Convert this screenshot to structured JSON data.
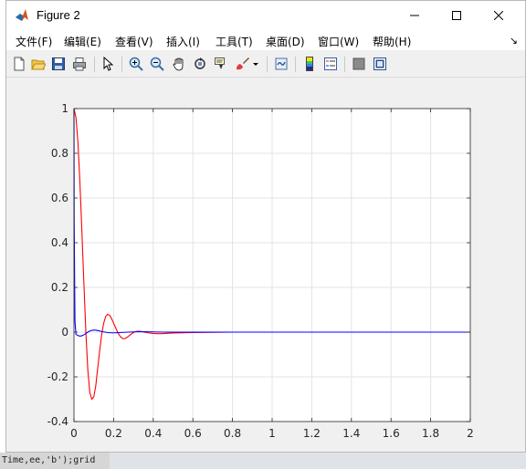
{
  "window": {
    "title": "Figure 2"
  },
  "menu": {
    "items": [
      "文件(F)",
      "编辑(E)",
      "查看(V)",
      "插入(I)",
      "工具(T)",
      "桌面(D)",
      "窗口(W)",
      "帮助(H)"
    ]
  },
  "toolbar": {
    "buttons": [
      "new-figure-icon",
      "open-file-icon",
      "save-icon",
      "print-icon",
      "pointer-icon",
      "zoom-in-icon",
      "zoom-out-icon",
      "pan-icon",
      "rotate-3d-icon",
      "data-cursor-icon",
      "brush-icon",
      "link-plot-icon",
      "colorbar-icon",
      "legend-icon",
      "hide-plot-tools-icon",
      "show-plot-tools-icon"
    ]
  },
  "background": {
    "bottom_text": "Time,ee,'b');grid"
  },
  "chart_data": {
    "type": "line",
    "xlim": [
      0,
      2
    ],
    "ylim": [
      -0.4,
      1
    ],
    "xticks": [
      "0",
      "0.2",
      "0.4",
      "0.6",
      "0.8",
      "1",
      "1.2",
      "1.4",
      "1.6",
      "1.8",
      "2"
    ],
    "yticks": [
      "-0.4",
      "-0.2",
      "0",
      "0.2",
      "0.4",
      "0.6",
      "0.8",
      "1"
    ],
    "grid": true,
    "series": [
      {
        "color": "#ff0000",
        "x": [
          0,
          0.01,
          0.02,
          0.03,
          0.04,
          0.05,
          0.06,
          0.07,
          0.08,
          0.09,
          0.1,
          0.11,
          0.12,
          0.13,
          0.14,
          0.15,
          0.16,
          0.17,
          0.18,
          0.19,
          0.2,
          0.21,
          0.22,
          0.23,
          0.24,
          0.25,
          0.26,
          0.27,
          0.28,
          0.29,
          0.3,
          0.31,
          0.32,
          0.33,
          0.34,
          0.35,
          0.36,
          0.38,
          0.4,
          0.42,
          0.44,
          0.46,
          0.48,
          0.5,
          0.55,
          0.6,
          0.7,
          0.8,
          1.0,
          1.2,
          1.5,
          2.0
        ],
        "y": [
          1,
          0.96,
          0.85,
          0.67,
          0.45,
          0.22,
          0.0,
          -0.17,
          -0.27,
          -0.3,
          -0.29,
          -0.24,
          -0.16,
          -0.08,
          -0.01,
          0.04,
          0.07,
          0.08,
          0.075,
          0.06,
          0.04,
          0.02,
          0.0,
          -0.015,
          -0.025,
          -0.03,
          -0.028,
          -0.022,
          -0.015,
          -0.008,
          -0.002,
          0.002,
          0.004,
          0.004,
          0.003,
          0.001,
          -0.001,
          -0.004,
          -0.006,
          -0.007,
          -0.007,
          -0.006,
          -0.005,
          -0.004,
          -0.003,
          -0.002,
          -0.001,
          0.0,
          0.0,
          0.0,
          0.0,
          0.0
        ]
      },
      {
        "color": "#0000ff",
        "x": [
          0,
          0.001,
          0.005,
          0.01,
          0.02,
          0.03,
          0.04,
          0.05,
          0.06,
          0.07,
          0.08,
          0.09,
          0.1,
          0.11,
          0.12,
          0.13,
          0.14,
          0.15,
          0.17,
          0.19,
          0.21,
          0.23,
          0.25,
          0.3,
          0.35,
          0.4,
          0.45,
          0.5,
          0.6,
          0.8,
          1.0,
          1.5,
          2.0
        ],
        "y": [
          1,
          0.5,
          0.05,
          -0.01,
          -0.015,
          -0.018,
          -0.016,
          -0.012,
          -0.006,
          0.0,
          0.005,
          0.008,
          0.009,
          0.009,
          0.007,
          0.005,
          0.003,
          0.001,
          -0.002,
          -0.003,
          -0.003,
          -0.002,
          -0.001,
          0.001,
          0.002,
          0.001,
          0.0,
          0.0,
          0.0,
          0.0,
          0.0,
          0.0,
          0.0
        ]
      }
    ]
  }
}
